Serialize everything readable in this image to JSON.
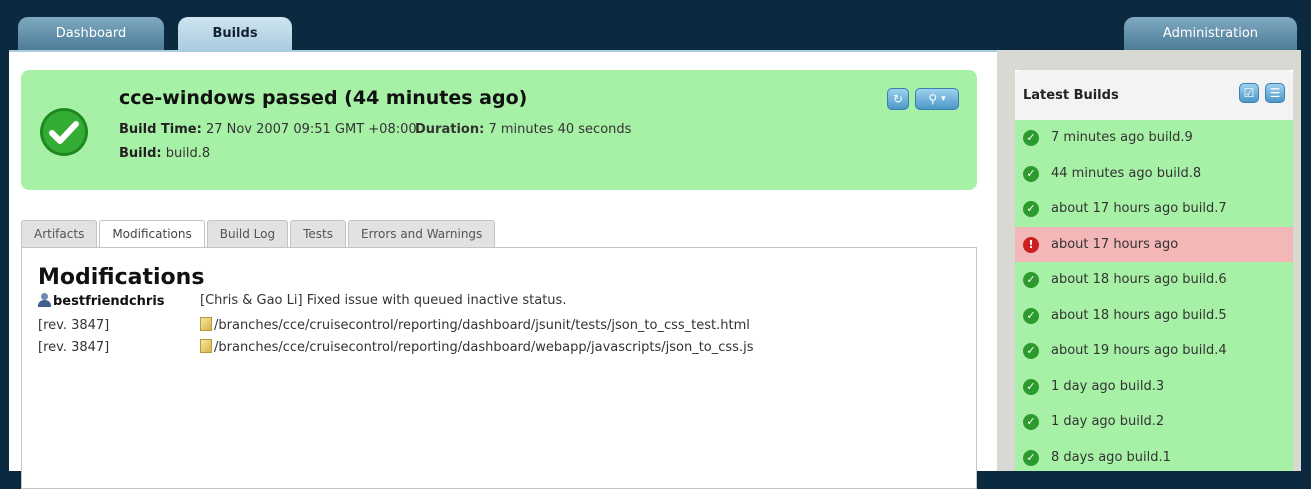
{
  "nav": {
    "dashboard": "Dashboard",
    "builds": "Builds",
    "administration": "Administration"
  },
  "banner": {
    "title": "cce-windows passed (44 minutes ago)",
    "build_time_label": "Build Time:",
    "build_time_value": "27 Nov 2007 09:51 GMT +08:00",
    "duration_label": "Duration:",
    "duration_value": "7 minutes 40 seconds",
    "build_label": "Build:",
    "build_value": "build.8",
    "status_color": "#a7f1a7",
    "icons": [
      "refresh-icon",
      "search-icon",
      "dropdown-arrow-icon"
    ]
  },
  "detail_tabs": [
    "Artifacts",
    "Modifications",
    "Build Log",
    "Tests",
    "Errors and Warnings"
  ],
  "active_tab": "Modifications",
  "modifications": {
    "heading": "Modifications",
    "user": "bestfriendchris",
    "message": "[Chris & Gao Li] Fixed issue with queued inactive status.",
    "files": [
      {
        "rev": "[rev. 3847]",
        "path": "/branches/cce/cruisecontrol/reporting/dashboard/jsunit/tests/json_to_css_test.html"
      },
      {
        "rev": "[rev. 3847]",
        "path": "/branches/cce/cruisecontrol/reporting/dashboard/webapp/javascripts/json_to_css.js"
      }
    ]
  },
  "latest_builds": {
    "title": "Latest Builds",
    "icons": [
      "checklist-icon",
      "list-icon"
    ],
    "items": [
      {
        "label": "7 minutes ago build.9",
        "status": "passed"
      },
      {
        "label": "44 minutes ago build.8",
        "status": "passed"
      },
      {
        "label": "about 17 hours ago build.7",
        "status": "passed"
      },
      {
        "label": "about 17 hours ago",
        "status": "failed"
      },
      {
        "label": "about 18 hours ago build.6",
        "status": "passed"
      },
      {
        "label": "about 18 hours ago build.5",
        "status": "passed"
      },
      {
        "label": "about 19 hours ago build.4",
        "status": "passed"
      },
      {
        "label": "1 day ago build.3",
        "status": "passed"
      },
      {
        "label": "1 day ago build.2",
        "status": "passed"
      },
      {
        "label": "8 days ago build.1",
        "status": "passed"
      }
    ],
    "passed_color": "#a7f1a7",
    "failed_color": "#f4b7b7"
  }
}
